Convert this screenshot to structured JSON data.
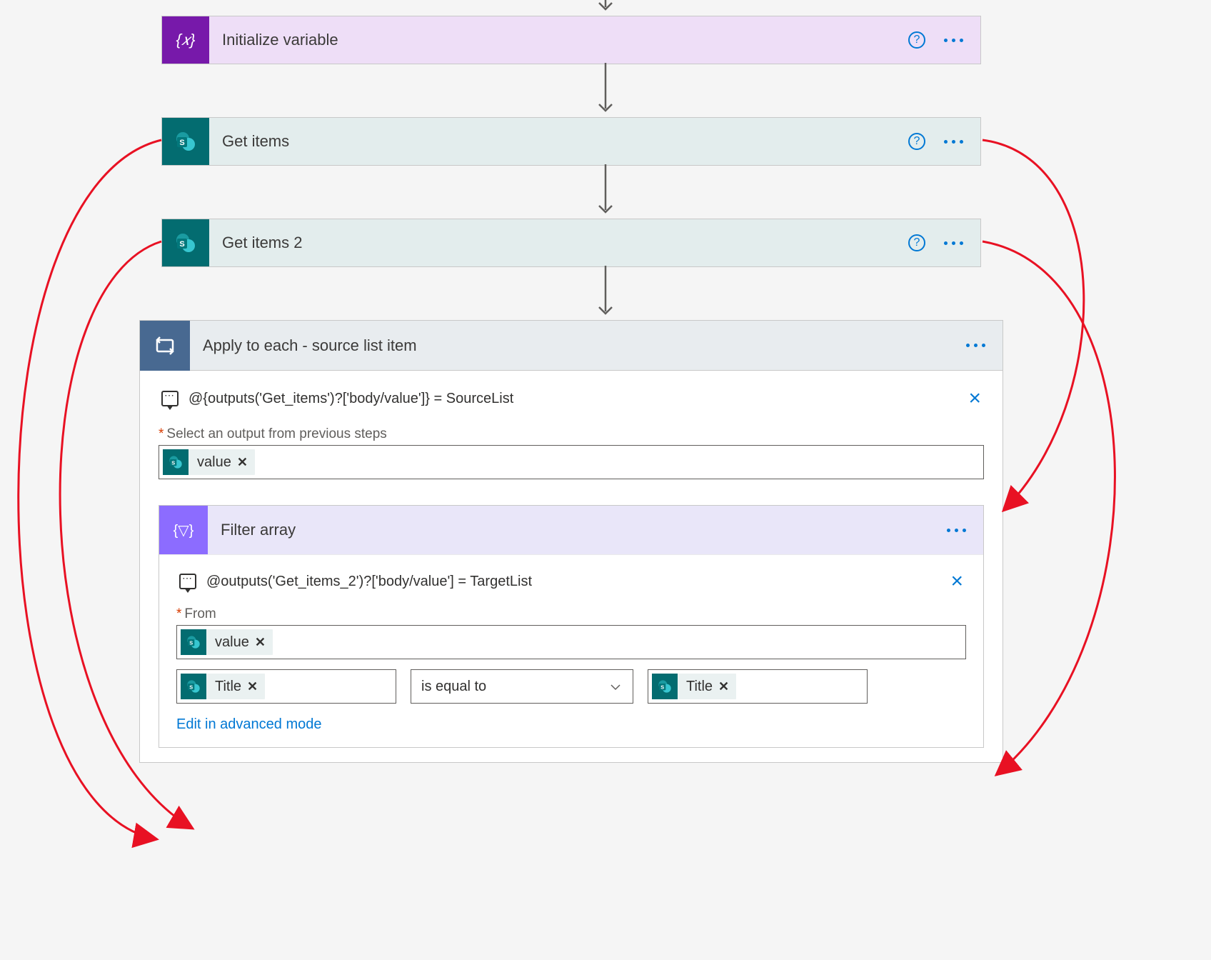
{
  "actions": {
    "initVar": {
      "title": "Initialize variable"
    },
    "getItems": {
      "title": "Get items"
    },
    "getItems2": {
      "title": "Get items 2"
    },
    "applyEach": {
      "title": "Apply to each - source list item",
      "comment": "@{outputs('Get_items')?['body/value']} = SourceList",
      "selectLabel": "Select an output from previous steps",
      "token": "value"
    },
    "filterArray": {
      "title": "Filter array",
      "comment": "@outputs('Get_items_2')?['body/value'] = TargetList",
      "fromLabel": "From",
      "fromToken": "value",
      "leftToken": "Title",
      "operator": "is equal to",
      "rightToken": "Title",
      "advancedLink": "Edit in advanced mode"
    }
  }
}
